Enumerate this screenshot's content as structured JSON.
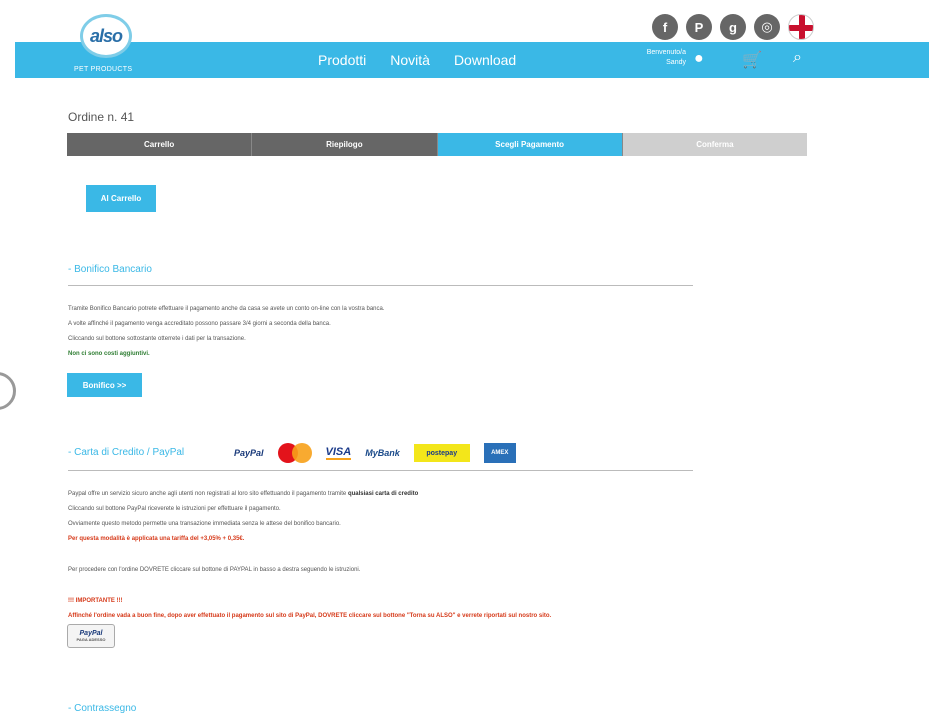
{
  "social": {
    "icons": [
      {
        "name": "facebook-icon",
        "glyph": "f"
      },
      {
        "name": "pinterest-icon",
        "glyph": "P"
      },
      {
        "name": "google-plus-icon",
        "glyph": "g"
      },
      {
        "name": "instagram-icon",
        "glyph": "◎"
      }
    ],
    "language_icon": "uk-flag-icon"
  },
  "header": {
    "logo_text": "also",
    "logo_subtitle": "PET PRODUCTS",
    "nav": [
      "Prodotti",
      "Novità",
      "Download"
    ],
    "welcome_line1": "Benvenuto/a",
    "welcome_line2": "Sandy",
    "accent": "#3ab8e6"
  },
  "order": {
    "title": "Ordine n. 41",
    "steps": [
      "Carrello",
      "Riepilogo",
      "Scegli Pagamento",
      "Conferma"
    ],
    "active_step": "Scegli Pagamento",
    "back_button": "Al Carrello"
  },
  "bonifico": {
    "title": "- Bonifico Bancario",
    "lines": [
      "Tramite Bonifico Bancario potrete effettuare il pagamento anche da casa se avete un conto on-line con la vostra banca.",
      "A volte affinché il pagamento venga accreditato possono passare 3/4 giorni a seconda della banca.",
      "Cliccando sul bottone sottostante otterrete i dati per la transazione."
    ],
    "note": "Non ci sono costi aggiuntivi.",
    "button": "Bonifico >>"
  },
  "carta": {
    "title": "- Carta di Credito / PayPal",
    "logos": [
      "PayPal",
      "MasterCard",
      "VISA",
      "MyBank",
      "postepay",
      "AMEX"
    ],
    "line1_pre": "Paypal offre un servizio sicuro anche agli utenti non registrati al loro sito effettuando il pagamento tramite ",
    "line1_bold": "qualsiasi carta di credito",
    "line2": "Cliccando sul bottone PayPal riceverete le istruzioni per effettuare il pagamento.",
    "line3": "Ovviamente questo metodo permette una transazione immediata senza le attese del bonifico bancario.",
    "fee": "Per questa modalità è applicata una tariffa del +3,05% + 0,35€.",
    "proceed": "Per procedere con l'ordine DOVRETE cliccare sul bottone di PAYPAL in basso a destra seguendo le istruzioni.",
    "important_title": "!!! IMPORTANTE !!!",
    "important_text": "Affinché l'ordine vada a buon fine, dopo aver effettuato il pagamento sul sito di PayPal, DOVRETE cliccare sul bottone \"Torna su ALSO\" e verrete riportati sul nostro sito.",
    "paypal_button": "PayPal",
    "paypal_button_sub": "PAGA ADESSO"
  },
  "contrassegno": {
    "title": "- Contrassegno"
  }
}
